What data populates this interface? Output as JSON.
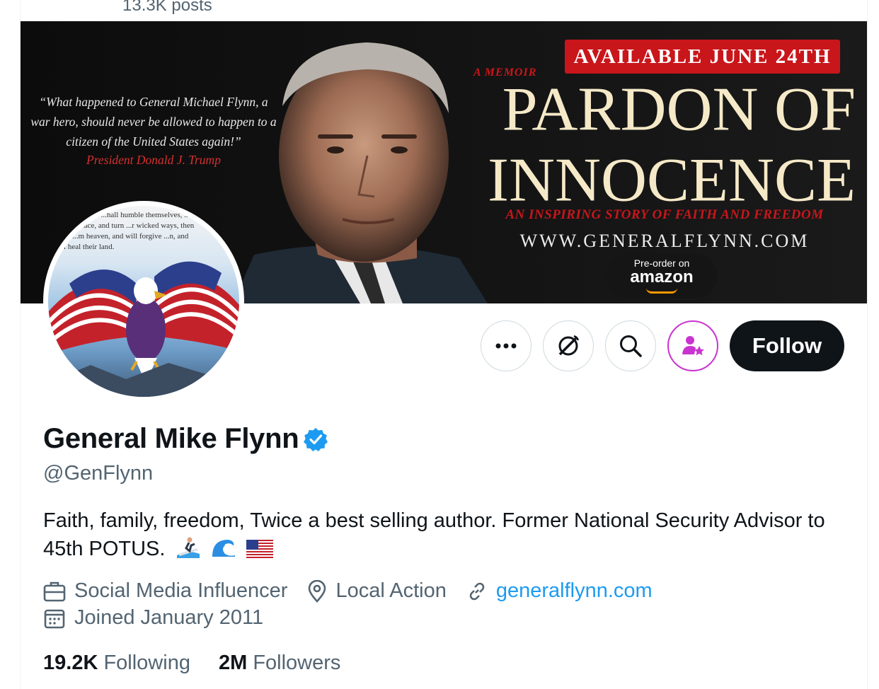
{
  "header": {
    "post_count": "13.3K posts"
  },
  "banner": {
    "quote": "“What happened to General Michael Flynn, a war hero, should never be allowed to happen to a citizen of the United States again!”",
    "quote_attribution": "President Donald J. Trump",
    "badge": "AVAILABLE JUNE 24TH",
    "kicker": "A MEMOIR",
    "title_line1": "PARDON OF",
    "title_line2": "INNOCENCE",
    "subtitle": "AN INSPIRING STORY OF FAITH AND FREEDOM",
    "website": "WWW.GENERALFLYNN.COM",
    "preorder": "Pre-order on",
    "store": "amazon"
  },
  "avatar": {
    "verse": "...en are called ...hall humble themselves, ...d seek my face, and turn ...r wicked ways, then will I ...m heaven, and will forgive ...n, and will heal their land."
  },
  "actions": {
    "more_icon": "more-icon",
    "grok_icon": "grok-icon",
    "search_icon": "search-icon",
    "subscribe_icon": "subscribe-icon",
    "follow_label": "Follow"
  },
  "profile": {
    "display_name": "General Mike Flynn",
    "verified": true,
    "handle": "@GenFlynn",
    "bio": "Faith, family, freedom, Twice a best selling author. Former National Security Advisor to 45th POTUS.",
    "bio_emojis": [
      "surfer",
      "wave",
      "us-flag"
    ],
    "category": "Social Media Influencer",
    "location": "Local Action",
    "website": "generalflynn.com",
    "joined": "Joined January 2011"
  },
  "stats": {
    "following_count": "19.2K",
    "following_label": "Following",
    "followers_count": "2M",
    "followers_label": "Followers"
  },
  "colors": {
    "accent_link": "#1d9bf0",
    "verified_blue": "#1d9bf0",
    "banner_red": "#c8161b",
    "subscribe_purple": "#c934d0"
  }
}
